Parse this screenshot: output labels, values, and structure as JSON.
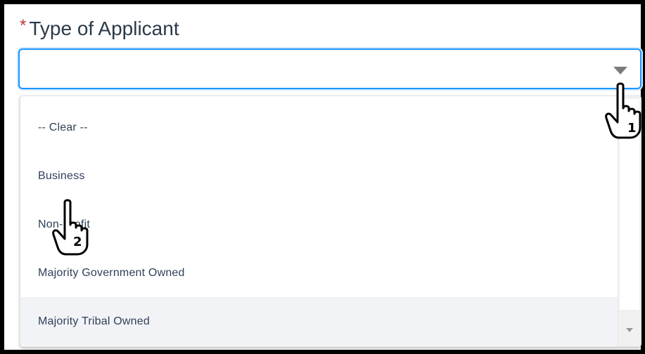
{
  "field": {
    "required_marker": "*",
    "label": "Type of Applicant",
    "value": ""
  },
  "options": [
    "-- Clear --",
    "Business",
    "Non-Profit",
    "Majority Government Owned",
    "Majority Tribal Owned"
  ],
  "highlighted_option": "Majority Tribal Owned",
  "annotations": {
    "step1": "1",
    "step2": "2"
  },
  "icons": {
    "caret": "chevron-down-icon",
    "pointer": "hand-pointer-icon"
  }
}
